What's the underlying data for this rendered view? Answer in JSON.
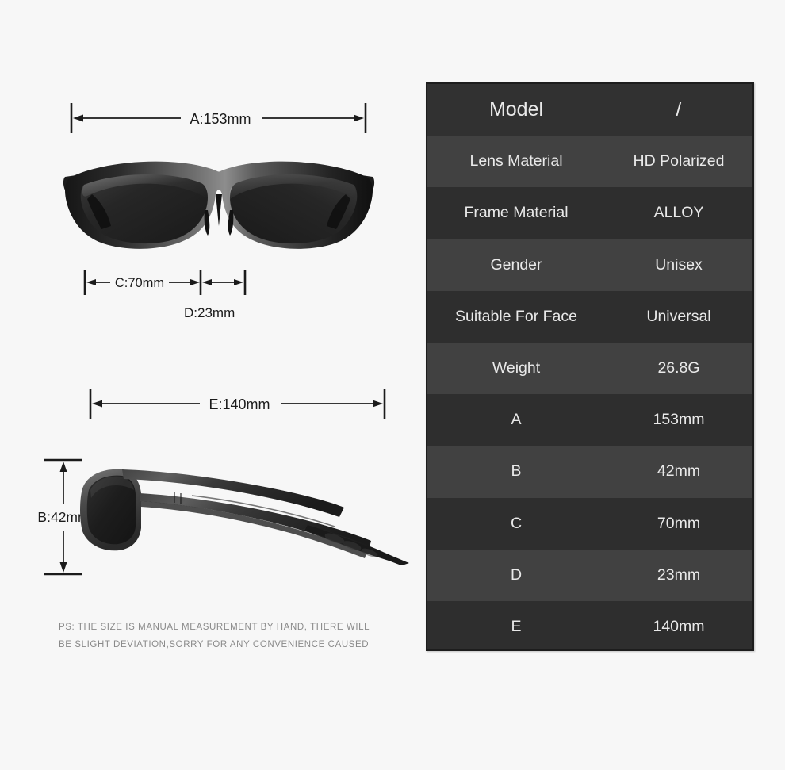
{
  "background_color": "#f7f7f7",
  "spec_table": {
    "name": "product-specification-table",
    "row_colors": {
      "dark": "#2e2e2e",
      "light": "#414141",
      "header": "#313131"
    },
    "text_color": "#e9e9e9",
    "rows": [
      {
        "key": "Model",
        "value": "/"
      },
      {
        "key": "Lens Material",
        "value": "HD Polarized"
      },
      {
        "key": "Frame Material",
        "value": "ALLOY"
      },
      {
        "key": "Gender",
        "value": "Unisex"
      },
      {
        "key": "Suitable For Face",
        "value": "Universal"
      },
      {
        "key": "Weight",
        "value": "26.8G"
      },
      {
        "key": "A",
        "value": "153mm"
      },
      {
        "key": "B",
        "value": "42mm"
      },
      {
        "key": "C",
        "value": "70mm"
      },
      {
        "key": "D",
        "value": "23mm"
      },
      {
        "key": "E",
        "value": "140mm"
      }
    ]
  },
  "dimensions": {
    "a": "A:153mm",
    "b": "B:42mm",
    "c": "C:70mm",
    "d": "D:23mm",
    "e": "E:140mm"
  },
  "disclaimer": {
    "line1": "PS: THE SIZE IS MANUAL MEASUREMENT BY HAND, THERE WILL",
    "line2": "BE SLIGHT DEVIATION,SORRY FOR ANY CONVENIENCE CAUSED"
  },
  "product": {
    "front_view_alt": "sunglasses-front-view",
    "side_view_alt": "sunglasses-side-view"
  }
}
